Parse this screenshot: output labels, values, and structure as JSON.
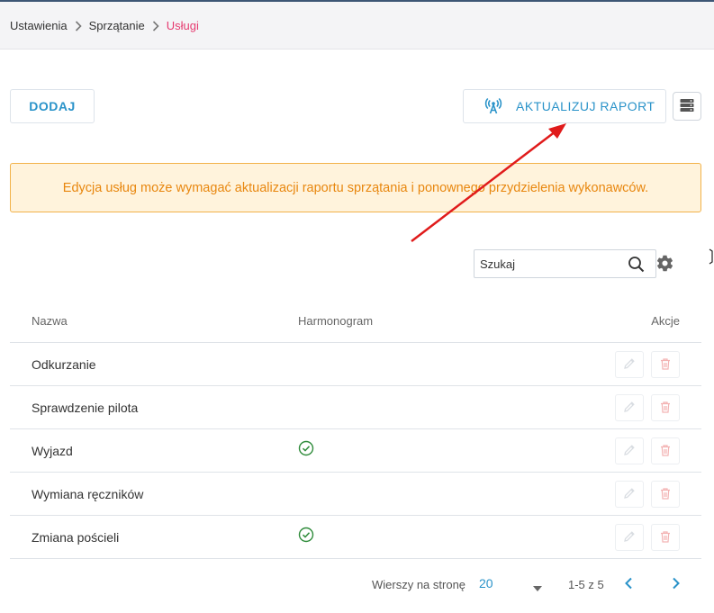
{
  "breadcrumb": {
    "items": [
      "Ustawienia",
      "Sprzątanie",
      "Usługi"
    ]
  },
  "toolbar": {
    "add_label": "DODAJ",
    "report_label": "AKTUALIZUJ RAPORT"
  },
  "alert": {
    "text": "Edycja usług może wymagać aktualizacji raportu sprzątania i ponownego przydzielenia wykonawców."
  },
  "search": {
    "placeholder": "Szukaj"
  },
  "table": {
    "columns": {
      "name": "Nazwa",
      "schedule": "Harmonogram",
      "actions": "Akcje"
    },
    "rows": [
      {
        "name": "Odkurzanie",
        "schedule": false
      },
      {
        "name": "Sprawdzenie pilota",
        "schedule": false
      },
      {
        "name": "Wyjazd",
        "schedule": true
      },
      {
        "name": "Wymiana ręczników",
        "schedule": false
      },
      {
        "name": "Zmiana pościeli",
        "schedule": true
      }
    ]
  },
  "pagination": {
    "rows_per_page_label": "Wierszy na stronę",
    "rows_per_page_value": "20",
    "range": "1-5 z 5"
  },
  "colors": {
    "accent": "#2a93c9",
    "breadcrumb_active": "#e63b70",
    "alert_bg": "#fff3dc",
    "alert_text": "#e8870f",
    "check": "#2e8b3a",
    "annotation_arrow": "#e01b1b"
  },
  "icons": {
    "report": "antenna-icon",
    "server": "server-icon",
    "search": "search-icon",
    "settings": "gear-icon",
    "edit": "pencil-icon",
    "delete": "trash-icon",
    "schedule": "check-circle-icon"
  }
}
